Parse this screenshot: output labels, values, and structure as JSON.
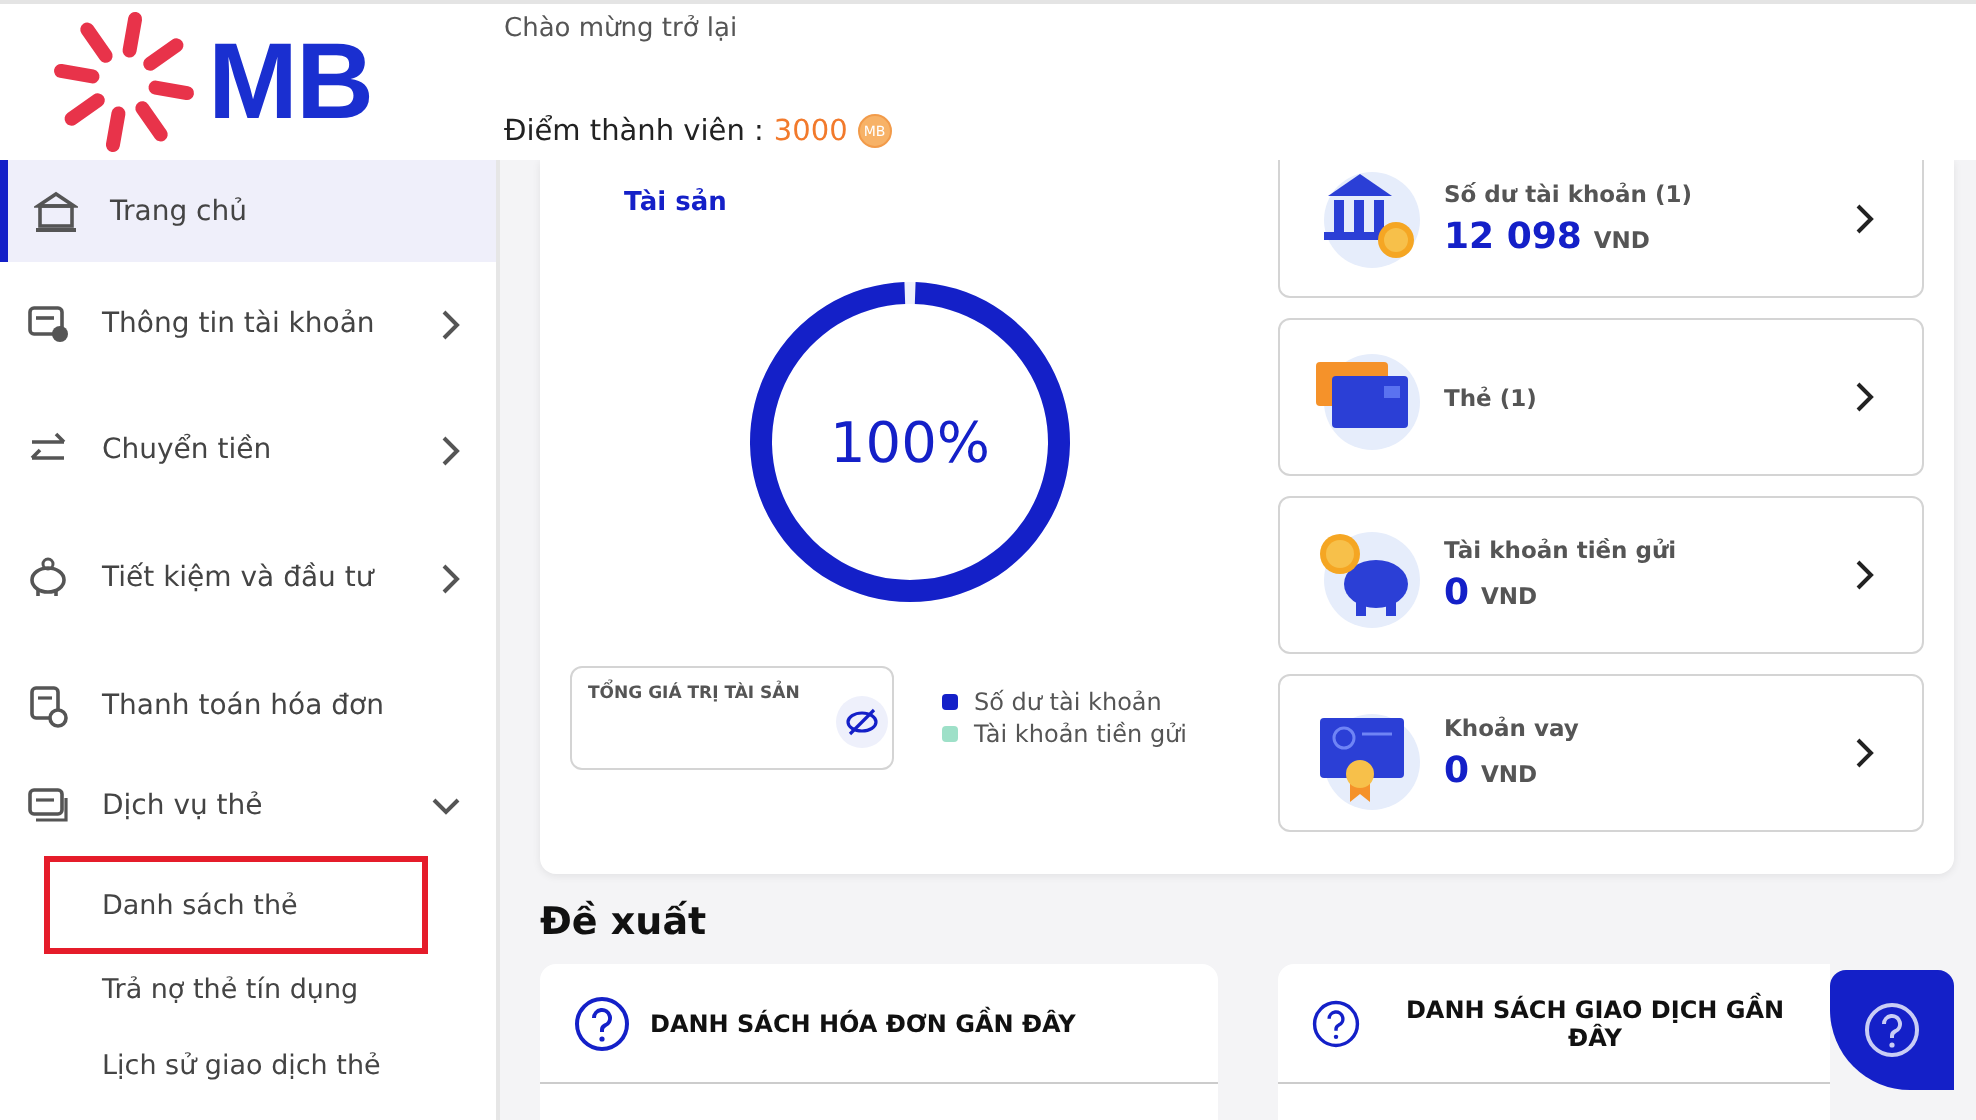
{
  "header": {
    "logo_text": "MB",
    "greeting": "Chào mừng trở lại",
    "points_label": "Điểm thành viên :",
    "points": "3000",
    "coin_text": "MB"
  },
  "sidebar": {
    "items": [
      {
        "label": "Trang chủ",
        "kind": "link",
        "selected": true
      },
      {
        "label": "Thông tin tài khoản",
        "kind": "group",
        "selected": false,
        "expanded": false
      },
      {
        "label": "Chuyển tiền",
        "kind": "group",
        "selected": false,
        "expanded": false
      },
      {
        "label": "Tiết kiệm và đầu tư",
        "kind": "group",
        "selected": false,
        "expanded": false
      },
      {
        "label": "Thanh toán hóa đơn",
        "kind": "link",
        "selected": false
      },
      {
        "label": "Dịch vụ thẻ",
        "kind": "group",
        "selected": false,
        "expanded": true,
        "children": [
          {
            "label": "Danh sách thẻ",
            "highlighted": true
          },
          {
            "label": "Trả nợ thẻ tín dụng",
            "highlighted": false
          },
          {
            "label": "Lịch sử giao dịch thẻ",
            "highlighted": false
          }
        ]
      }
    ]
  },
  "assets": {
    "title": "Tài sản",
    "center_label": "100%",
    "ring": {
      "level": 1
    },
    "legend": [
      {
        "label": "Số dư tài khoản",
        "color": "#1420c8"
      },
      {
        "label": "Tài khoản tiền gửi",
        "color": "#9ee0c8"
      }
    ],
    "total": {
      "label": "TỔNG GIÁ TRỊ TÀI SẢN"
    },
    "cards": [
      {
        "title": "Số dư tài khoản (1)",
        "amount": "12 098",
        "currency": "VND"
      },
      {
        "title": "Thẻ (1)"
      },
      {
        "title": "Tài khoản tiền gửi",
        "amount": "0",
        "currency": "VND"
      },
      {
        "title": "Khoản vay",
        "amount": "0",
        "currency": "VND"
      }
    ]
  },
  "suggest": {
    "title": "Đề xuất",
    "cards": [
      {
        "title": "DANH SÁCH HÓA ĐƠN GẦN ĐÂY"
      },
      {
        "title": "DANH SÁCH GIAO DỊCH GẦN ĐÂY"
      }
    ]
  }
}
